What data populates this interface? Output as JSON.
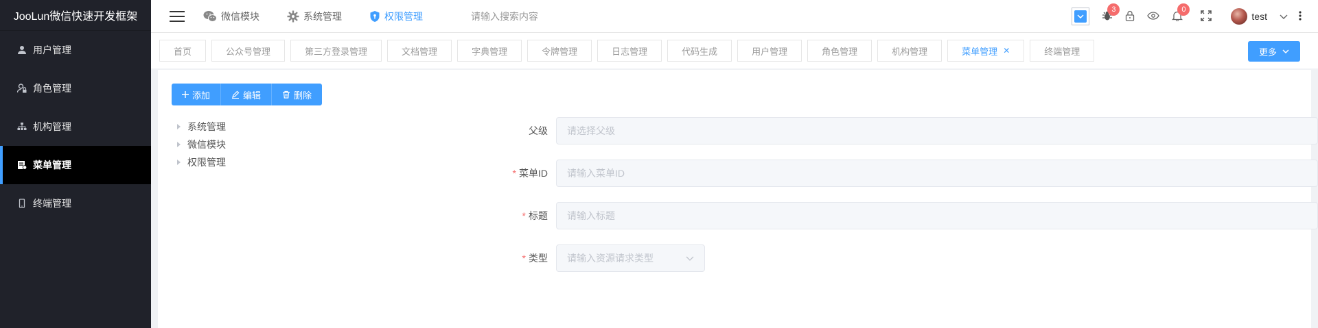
{
  "brand": {
    "title": "JooLun微信快速开发框架"
  },
  "sidebar": {
    "items": [
      {
        "label": "用户管理",
        "icon": "user-icon"
      },
      {
        "label": "角色管理",
        "icon": "user-lock-icon"
      },
      {
        "label": "机构管理",
        "icon": "sitemap-icon"
      },
      {
        "label": "菜单管理",
        "icon": "menu-doc-icon",
        "active": true
      },
      {
        "label": "终端管理",
        "icon": "mobile-icon"
      }
    ]
  },
  "header": {
    "nav": [
      {
        "label": "微信模块",
        "icon": "wechat-icon"
      },
      {
        "label": "系统管理",
        "icon": "gear-icon"
      },
      {
        "label": "权限管理",
        "icon": "shield-icon",
        "active": true
      }
    ],
    "search_placeholder": "请输入搜索内容",
    "bug_count": "3",
    "notification_count": "0",
    "username": "test"
  },
  "tabs": {
    "items": [
      "首页",
      "公众号管理",
      "第三方登录管理",
      "文档管理",
      "字典管理",
      "令牌管理",
      "日志管理",
      "代码生成",
      "用户管理",
      "角色管理",
      "机构管理",
      "菜单管理",
      "终端管理"
    ],
    "active": "菜单管理",
    "more_label": "更多"
  },
  "toolbar": {
    "add_label": "添加",
    "edit_label": "编辑",
    "delete_label": "删除"
  },
  "tree": {
    "nodes": [
      "系统管理",
      "微信模块",
      "权限管理"
    ]
  },
  "form": {
    "parent": {
      "label": "父级",
      "placeholder": "请选择父级",
      "required": false
    },
    "menu_id": {
      "label": "菜单ID",
      "placeholder": "请输入菜单ID",
      "required": true
    },
    "title": {
      "label": "标题",
      "placeholder": "请输入标题",
      "required": true
    },
    "type": {
      "label": "类型",
      "placeholder": "请输入资源请求类型",
      "required": true
    }
  },
  "colors": {
    "accent": "#409eff",
    "sidebar_bg": "#20222a",
    "badge": "#f56c6c"
  }
}
